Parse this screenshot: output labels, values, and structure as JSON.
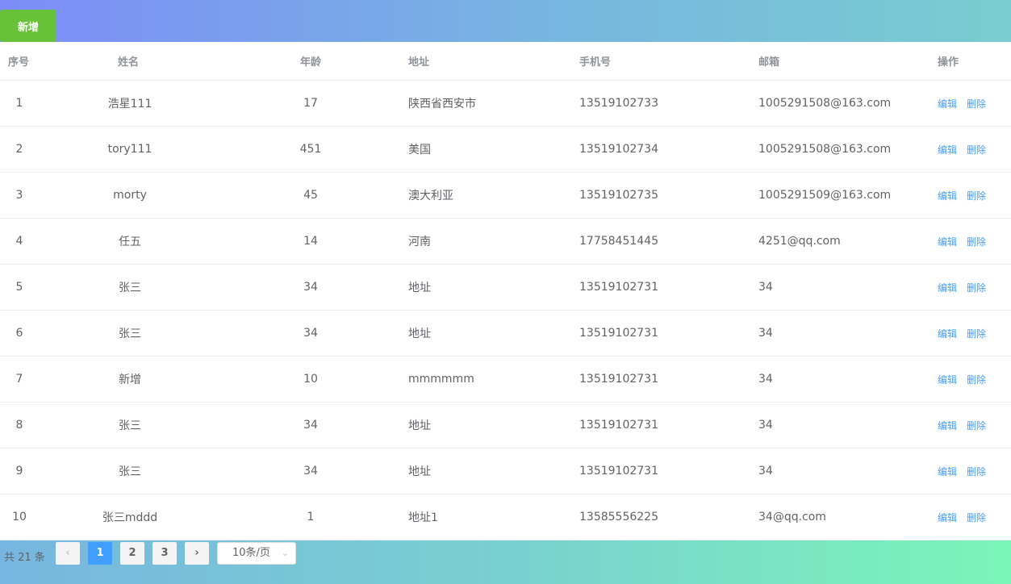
{
  "toolbar": {
    "add_label": "新增"
  },
  "table": {
    "headers": {
      "index": "序号",
      "name": "姓名",
      "age": "年龄",
      "address": "地址",
      "phone": "手机号",
      "email": "邮箱",
      "ops": "操作"
    },
    "ops": {
      "edit": "编辑",
      "delete": "删除"
    },
    "rows": [
      {
        "index": "1",
        "name": "浩星111",
        "age": "17",
        "address": "陕西省西安市",
        "phone": "13519102733",
        "email": "1005291508@163.com"
      },
      {
        "index": "2",
        "name": "tory111",
        "age": "451",
        "address": "美国",
        "phone": "13519102734",
        "email": "1005291508@163.com"
      },
      {
        "index": "3",
        "name": "morty",
        "age": "45",
        "address": "澳大利亚",
        "phone": "13519102735",
        "email": "1005291509@163.com"
      },
      {
        "index": "4",
        "name": "任五",
        "age": "14",
        "address": "河南",
        "phone": "17758451445",
        "email": "4251@qq.com"
      },
      {
        "index": "5",
        "name": "张三",
        "age": "34",
        "address": "地址",
        "phone": "13519102731",
        "email": "34"
      },
      {
        "index": "6",
        "name": "张三",
        "age": "34",
        "address": "地址",
        "phone": "13519102731",
        "email": "34"
      },
      {
        "index": "7",
        "name": "新增",
        "age": "10",
        "address": "mmmmmm",
        "phone": "13519102731",
        "email": "34"
      },
      {
        "index": "8",
        "name": "张三",
        "age": "34",
        "address": "地址",
        "phone": "13519102731",
        "email": "34"
      },
      {
        "index": "9",
        "name": "张三",
        "age": "34",
        "address": "地址",
        "phone": "13519102731",
        "email": "34"
      },
      {
        "index": "10",
        "name": "张三mddd",
        "age": "1",
        "address": "地址1",
        "phone": "13585556225",
        "email": "34@qq.com"
      }
    ]
  },
  "pagination": {
    "total": "共 21 条",
    "prev_icon": "chevron-left-icon",
    "next_icon": "chevron-right-icon",
    "pages": [
      "1",
      "2",
      "3"
    ],
    "current_page": "1",
    "page_size": "10条/页"
  },
  "colors": {
    "accent": "#409eff",
    "add_button": "#67c23a"
  }
}
